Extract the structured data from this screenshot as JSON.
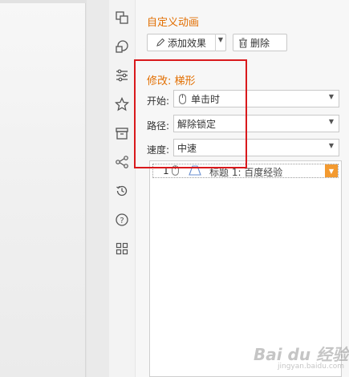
{
  "panel": {
    "title": "自定义动画",
    "add_effect": "添加效果",
    "delete": "删除",
    "modify_title": "修改: 梯形",
    "start_label": "开始:",
    "start_value": "单击时",
    "path_label": "路径:",
    "path_value": "解除锁定",
    "speed_label": "速度:",
    "speed_value": "中速",
    "list": [
      {
        "index": "1",
        "text": "标题 1: 百度经验"
      }
    ]
  },
  "sidebar_icons": [
    "switch-icon",
    "shapes-icon",
    "sliders-icon",
    "star-icon",
    "archive-icon",
    "share-icon",
    "history-icon",
    "help-icon",
    "grid-icon"
  ],
  "watermark": {
    "main": "Bai du 经验",
    "sub": "jingyan.baidu.com"
  },
  "colors": {
    "accent": "#e26e00",
    "highlight": "#d9191c",
    "dropdown": "#f39a30"
  }
}
